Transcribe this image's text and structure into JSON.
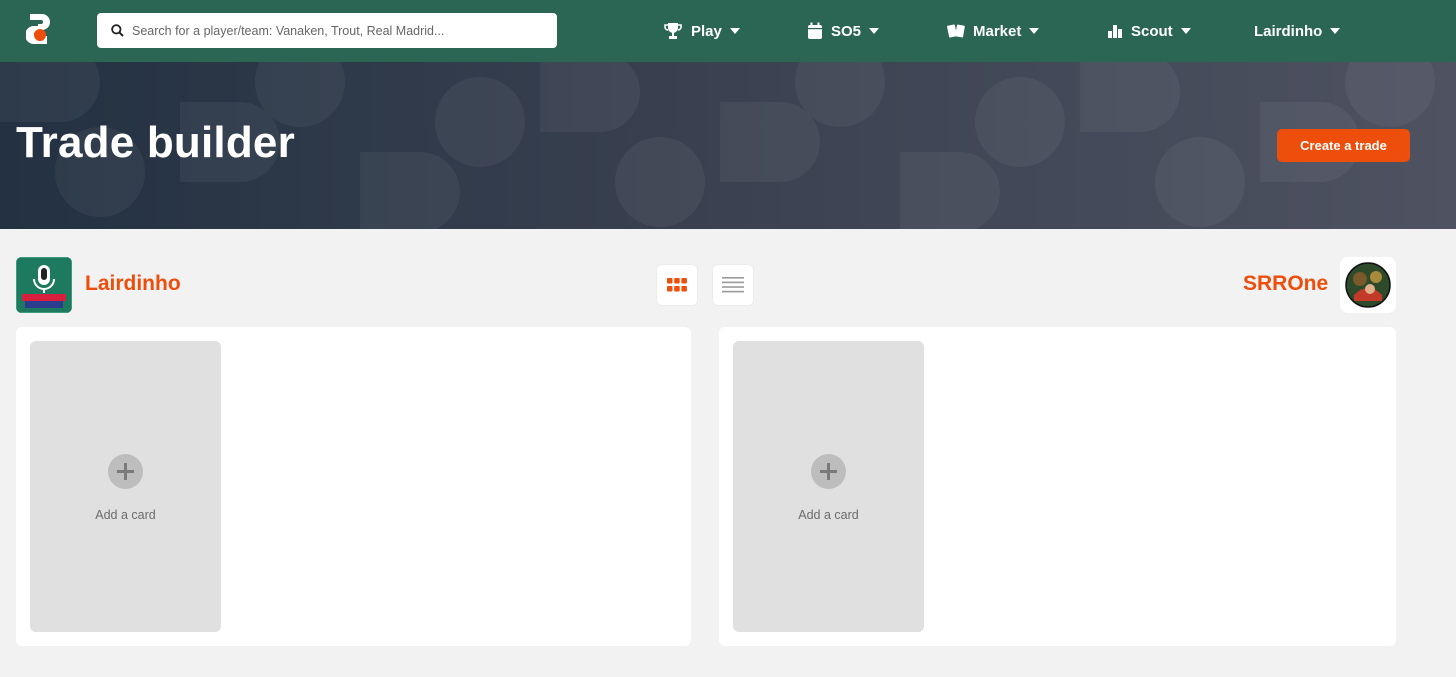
{
  "nav": {
    "search_placeholder": "Search for a player/team: Vanaken, Trout, Real Madrid...",
    "items": [
      {
        "label": "Play",
        "icon": "trophy-icon"
      },
      {
        "label": "SO5",
        "icon": "calendar-icon"
      },
      {
        "label": "Market",
        "icon": "cards-icon"
      },
      {
        "label": "Scout",
        "icon": "bar-chart-icon"
      },
      {
        "label": "Lairdinho",
        "icon": ""
      }
    ]
  },
  "hero": {
    "title": "Trade builder",
    "create_button": "Create a trade"
  },
  "trade": {
    "left_user": "Lairdinho",
    "right_user": "SRROne",
    "left_panel": {
      "add_card_label": "Add a card"
    },
    "right_panel": {
      "add_card_label": "Add a card"
    }
  },
  "colors": {
    "nav_bg": "#2b6553",
    "accent": "#ee4e0b",
    "hero_bg": "#38404f"
  }
}
